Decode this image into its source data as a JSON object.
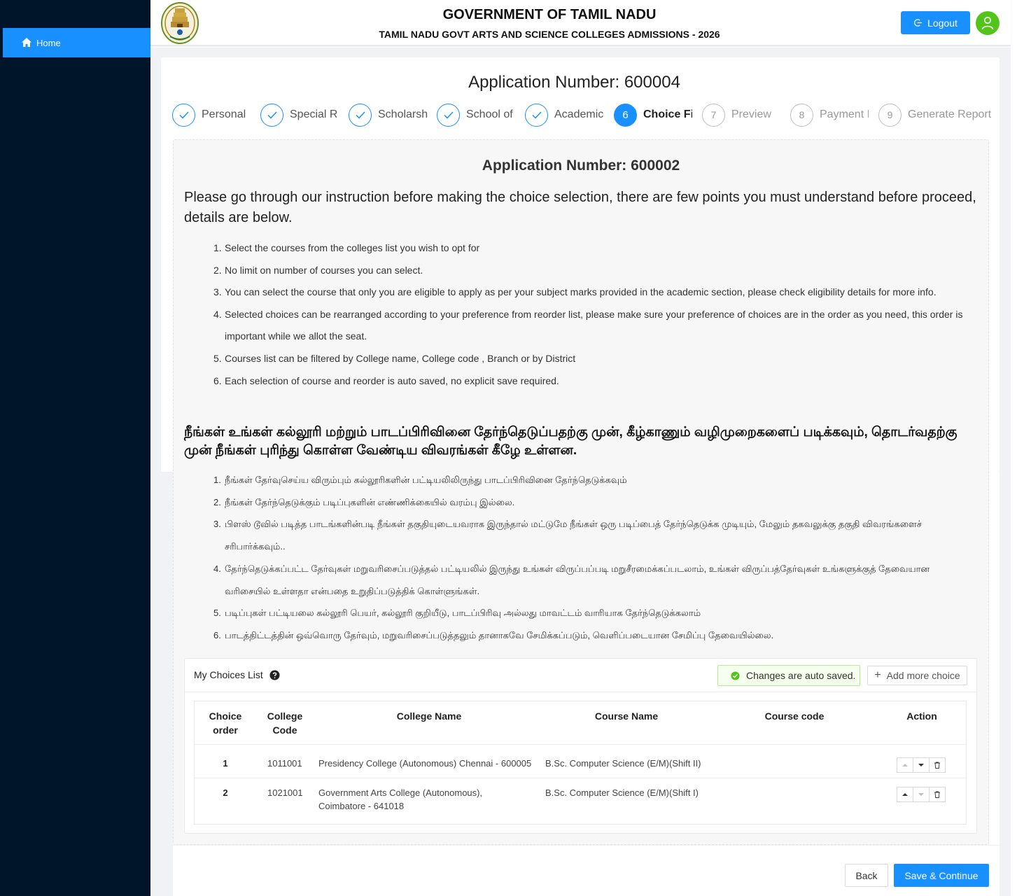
{
  "sidebar": {
    "home_label": "Home"
  },
  "header": {
    "title": "GOVERNMENT OF TAMIL NADU",
    "subtitle": "TAMIL NADU GOVT ARTS AND SCIENCE COLLEGES ADMISSIONS - 2026",
    "logout_label": "Logout"
  },
  "main": {
    "app_number": "Application Number: 600004",
    "steps": [
      {
        "label": "Personal I",
        "status": "done"
      },
      {
        "label": "Special Re",
        "status": "done"
      },
      {
        "label": "Scholarsh",
        "status": "done"
      },
      {
        "label": "School of",
        "status": "done"
      },
      {
        "label": "Academic",
        "status": "done"
      },
      {
        "num": "6",
        "label": "Choice Fil",
        "status": "current"
      },
      {
        "num": "7",
        "label": "Preview",
        "status": "pending"
      },
      {
        "num": "8",
        "label": "Payment I",
        "status": "pending"
      },
      {
        "num": "9",
        "label": "Generate Report",
        "status": "pending"
      }
    ]
  },
  "instructions": {
    "app_number": "Application Number: 600002",
    "intro": "Please go through our instruction before making the choice selection, there are few points you must understand before proceed, details are below.",
    "items": [
      "Select the courses from the colleges list you wish to opt for",
      "No limit on number of courses you can select.",
      "You can select the course that only you are eligible to apply as per your subject marks provided in the academic section, please check eligibility details for more info.",
      "Selected choices can be rearranged according to your preference from reorder list, please make sure your preference of choices are in the order as you need, this order is important while we allot the seat.",
      "Courses list can be filtered by College name, College code , Branch or by District",
      "Each selection of course and reorder is auto saved, no explicit save required."
    ],
    "tamil_intro": "நீங்கள் உங்கள் கல்லூரி மற்றும் பாடப்பிரிவினை தேர்ந்தெடுப்பதற்கு முன், கீழ்காணும் வழிமுறைகளைப் படிக்கவும், தொடர்வதற்கு முன் நீங்கள் புரிந்து கொள்ள வேண்டிய விவரங்கள் கீழே உள்ளன.",
    "tamil_items": [
      "நீங்கள் தேர்வுசெய்ய விரும்பும் கல்லூரிகளின் பட்டியலிலிருந்து பாடப்பிரிவினை தேர்ந்தெடுக்கவும்",
      "நீங்கள் தேர்ந்தெடுக்கும் படிப்புகளின் எண்ணிக்கையில் வரம்பு இல்லை.",
      "பிளஸ் டூவில் படித்த பாடங்களின்படி நீங்கள் தகுதியுடையவராக இருந்தால் மட்டுமே நீங்கள் ஒரு படிப்பைத் தேர்ந்தெடுக்க முடியும், மேலும் தகவலுக்கு தகுதி விவரங்களைச் சரிபார்க்கவும்..",
      "தேர்ந்தெடுக்கப்பட்ட தேர்வுகள் மறுவரிசைப்படுத்தல் பட்டியலில் இருந்து உங்கள் விருப்பப்படி மறுசீரமைக்கப்படலாம், உங்கள் விருப்பத்தேர்வுகள் உங்களுக்குத் தேவையான வரிசையில் உள்ளதா என்பதை உறுதிப்படுத்திக் கொள்ளுங்கள்.",
      "படிப்புகள் பட்டியலை கல்லூரி பெயர், கல்லூரி குறியீடு, பாடப்பிரிவு அல்லது மாவட்டம் வாரியாக தேர்ந்தெடுக்கலாம்",
      "பாடத்திட்டத்தின் ஒவ்வொரு தேர்வும், மறுவரிசைப்படுத்தலும் தானாகவே சேமிக்கப்படும், வெளிப்படையான சேமிப்பு தேவையில்லை."
    ]
  },
  "choices": {
    "title": "My Choices List",
    "autosave_text": "Changes are auto saved.",
    "add_label": "Add more choice",
    "headers": {
      "order_1": "Choice",
      "order_2": "order",
      "code_1": "College",
      "code_2": "Code",
      "college": "College Name",
      "course": "Course Name",
      "course_code": "Course code",
      "action": "Action"
    },
    "rows": [
      {
        "order": "1",
        "code": "1011001",
        "college": "Presidency College (Autonomous) Chennai - 600005",
        "course": "B.Sc. Computer Science (E/M)(Shift II)",
        "course_code": ""
      },
      {
        "order": "2",
        "code": "1021001",
        "college": "Government Arts College (Autonomous), Coimbatore - 641018",
        "course": "B.Sc. Computer Science (E/M)(Shift I)",
        "course_code": ""
      }
    ]
  },
  "footer": {
    "back_label": "Back",
    "save_label": "Save & Continue"
  },
  "colors": {
    "primary": "#1890ff",
    "sidebar": "#001529",
    "success": "#52c41a"
  }
}
